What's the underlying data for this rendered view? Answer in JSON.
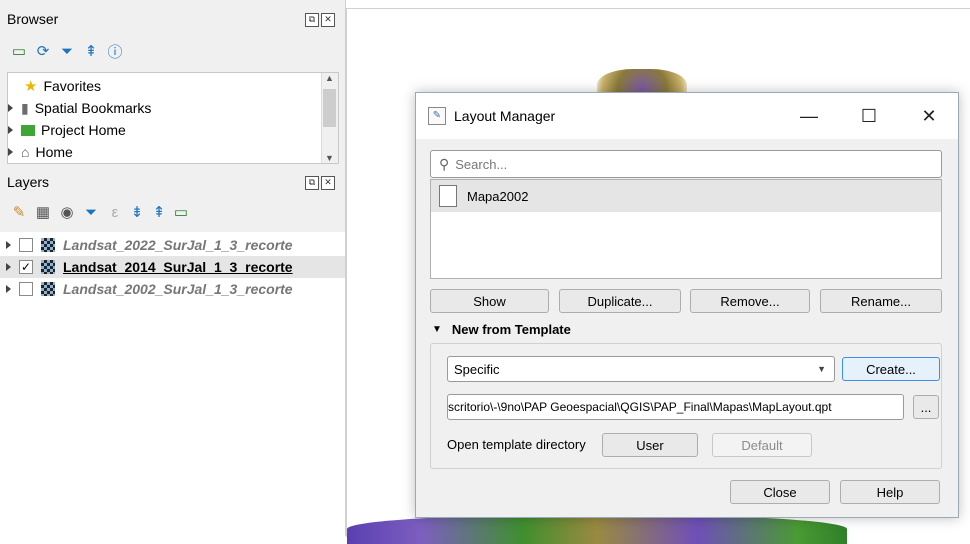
{
  "browser": {
    "title": "Browser",
    "tree": [
      {
        "label": "Favorites",
        "icon": "star-icon"
      },
      {
        "label": "Spatial Bookmarks",
        "icon": "bookmark-icon"
      },
      {
        "label": "Project Home",
        "icon": "project-home-icon"
      },
      {
        "label": "Home",
        "icon": "home-icon"
      }
    ]
  },
  "layers": {
    "title": "Layers",
    "items": [
      {
        "label": "Landsat_2022_SurJal_1_3_recorte",
        "checked": false
      },
      {
        "label": "Landsat_2014_SurJal_1_3_recorte",
        "checked": true
      },
      {
        "label": "Landsat_2002_SurJal_1_3_recorte",
        "checked": false
      }
    ]
  },
  "dialog": {
    "title": "Layout Manager",
    "search_placeholder": "Search...",
    "layouts": [
      {
        "name": "Mapa2002"
      }
    ],
    "buttons": {
      "show": "Show",
      "duplicate": "Duplicate...",
      "remove": "Remove...",
      "rename": "Rename..."
    },
    "section_title": "New from Template",
    "template_select": "Specific",
    "create_label": "Create...",
    "template_path": "scritorio\\-\\9no\\PAP Geoespacial\\QGIS\\PAP_Final\\Mapas\\MapLayout.qpt",
    "browse_label": "...",
    "open_dir_label": "Open template directory",
    "user_label": "User",
    "default_label": "Default",
    "close_label": "Close",
    "help_label": "Help"
  },
  "colors": {
    "accent": "#3d8ee8",
    "checkbox_mark": "#000000"
  }
}
